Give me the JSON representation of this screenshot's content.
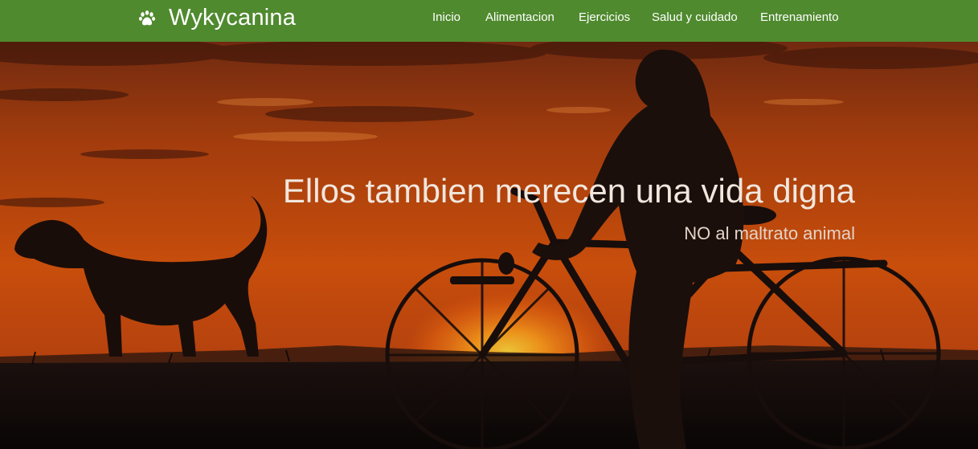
{
  "navbar": {
    "brand_name": "Wykycanina",
    "brand_icon": "paw-icon",
    "background_color": "#4f8a2e",
    "links": [
      {
        "label": "Inicio"
      },
      {
        "label": "Alimentacion"
      },
      {
        "label": "Ejercicios"
      },
      {
        "label": "Salud y cuidado"
      },
      {
        "label": "Entrenamiento"
      }
    ]
  },
  "hero": {
    "title": "Ellos tambien merecen una vida digna",
    "subtitle": "NO al maltrato animal",
    "image_subject": "silhouette of a dog and a person walking a bicycle at sunset"
  }
}
